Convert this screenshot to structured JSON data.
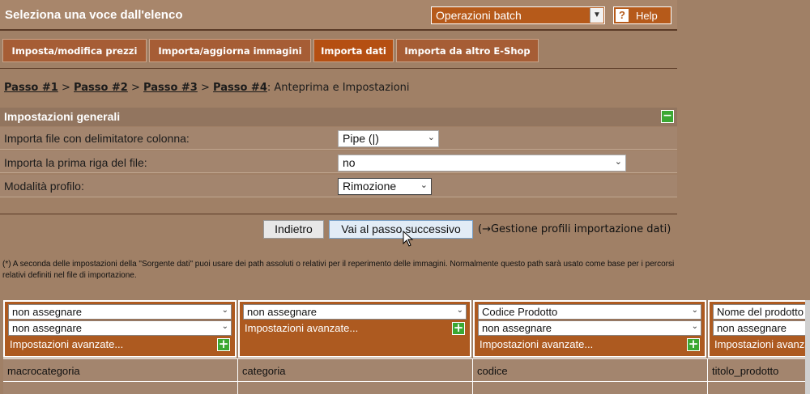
{
  "header": {
    "title": "Seleziona una voce dall'elenco",
    "batch_select": "Operazioni batch",
    "help_label": "Help",
    "help_q": "?"
  },
  "tabs": [
    {
      "label": "Imposta/modifica prezzi",
      "active": false
    },
    {
      "label": "Importa/aggiorna immagini",
      "active": false
    },
    {
      "label": "Importa dati",
      "active": true
    },
    {
      "label": "Importa da altro E-Shop",
      "active": false
    }
  ],
  "breadcrumb": {
    "step1": "Passo #1",
    "step2": "Passo #2",
    "step3": "Passo #3",
    "step4": "Passo #4",
    "sep": ">",
    "current": ": Anteprima e Impostazioni"
  },
  "settings": {
    "title": "Impostazioni generali",
    "rows": [
      {
        "label": "Importa file con delimitatore colonna:",
        "value": "Pipe (|)"
      },
      {
        "label": "Importa la prima riga del file:",
        "value": "no"
      },
      {
        "label": "Modalità profilo:",
        "value": "Rimozione"
      }
    ]
  },
  "buttons": {
    "back": "Indietro",
    "next": "Vai al passo successivo",
    "profiles_link": "(→Gestione profili importazione dati)"
  },
  "note": "(*) A seconda delle impostazioni della \"Sorgente dati\" puoi usare dei path assoluti o relativi per il reperimento delle immagini. Normalmente questo path sarà usato come base per i percorsi relativi definiti nel file di importazione.",
  "columns": [
    {
      "select1": "non assegnare",
      "select2": "non assegnare",
      "advanced": "Impostazioni avanzate...",
      "field": "macrocategoria"
    },
    {
      "select1": "non assegnare",
      "select2": "",
      "advanced": "Impostazioni avanzate...",
      "field": "categoria"
    },
    {
      "select1": "Codice Prodotto",
      "select2": "non assegnare",
      "advanced": "Impostazioni avanzate...",
      "field": "codice"
    },
    {
      "select1": "Nome del prodotto",
      "select2": "non assegnare",
      "advanced": "Impostazioni avanzate...",
      "field": "titolo_prodotto"
    }
  ],
  "colors": {
    "accent": "#b54f12",
    "background": "#a08066",
    "plus_green": "#3aa832"
  }
}
